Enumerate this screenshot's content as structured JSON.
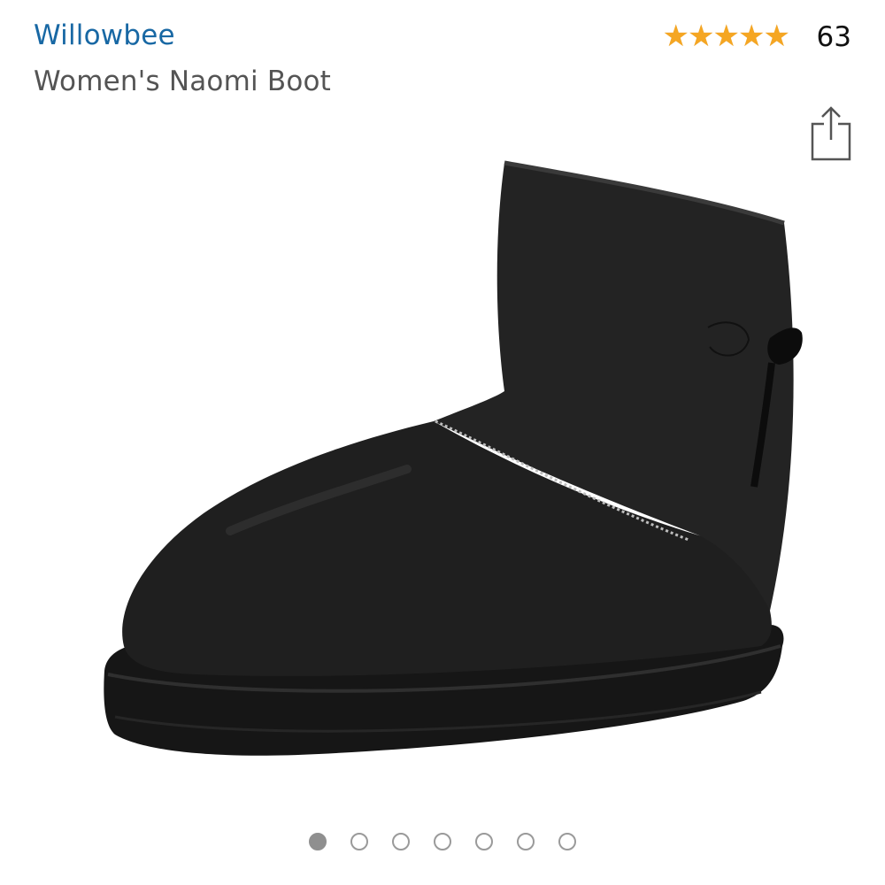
{
  "product": {
    "brand": "Willowbee",
    "title": "Women's Naomi Boot",
    "rating": {
      "stars": 4.5,
      "count": "63"
    },
    "image": {
      "icon": "boot-photo"
    },
    "carousel": {
      "total": 7,
      "active_index": 0
    }
  },
  "icons": {
    "share": "share-icon",
    "star": "star-icon"
  },
  "colors": {
    "brand_link": "#1868a4",
    "star_fill": "#f5a623",
    "star_empty": "#d9d9d9",
    "dot_active": "#8f8f8f"
  }
}
